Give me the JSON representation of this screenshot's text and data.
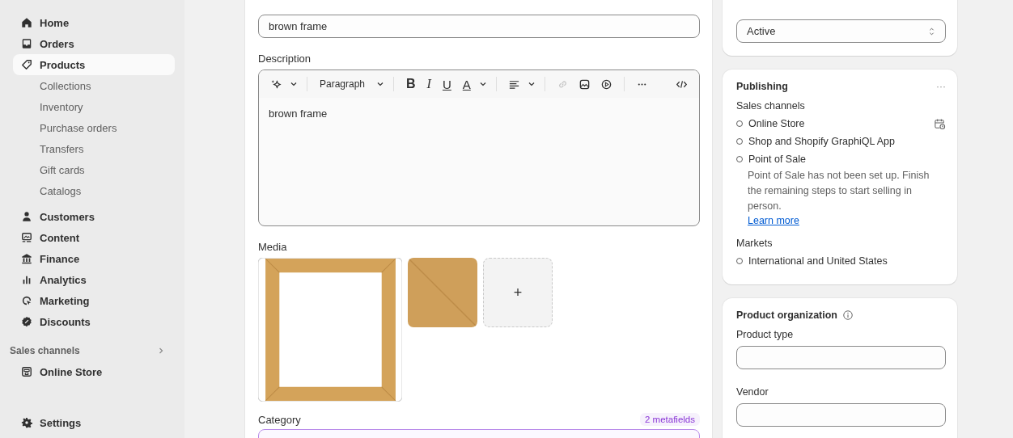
{
  "sidebar": {
    "items": [
      {
        "label": "Home",
        "kind": "nav",
        "selected": false
      },
      {
        "label": "Orders",
        "kind": "nav",
        "selected": false
      },
      {
        "label": "Products",
        "kind": "nav",
        "selected": true
      },
      {
        "label": "Collections",
        "kind": "sub",
        "selected": false
      },
      {
        "label": "Inventory",
        "kind": "sub",
        "selected": false
      },
      {
        "label": "Purchase orders",
        "kind": "sub",
        "selected": false
      },
      {
        "label": "Transfers",
        "kind": "sub",
        "selected": false
      },
      {
        "label": "Gift cards",
        "kind": "sub",
        "selected": false
      },
      {
        "label": "Catalogs",
        "kind": "sub",
        "selected": false
      },
      {
        "label": "Customers",
        "kind": "nav",
        "selected": false
      },
      {
        "label": "Content",
        "kind": "nav",
        "selected": false
      },
      {
        "label": "Finance",
        "kind": "nav",
        "selected": false
      },
      {
        "label": "Analytics",
        "kind": "nav",
        "selected": false
      },
      {
        "label": "Marketing",
        "kind": "nav",
        "selected": false
      },
      {
        "label": "Discounts",
        "kind": "nav",
        "selected": false
      }
    ],
    "section": {
      "title": "Sales channels",
      "items": [
        {
          "label": "Online Store",
          "selected": false
        }
      ]
    },
    "settings": "Settings"
  },
  "product": {
    "title_value": "brown frame",
    "description_label": "Description",
    "toolbar": {
      "style": "Paragraph",
      "bold": "B",
      "italic": "I",
      "underline": "U",
      "text_color_label": "A",
      "link_disabled": true
    },
    "description": "brown frame",
    "media_label": "Media",
    "add_media": "+",
    "category_label": "Category",
    "metafields": "2 metafields"
  },
  "status": {
    "value": "Active"
  },
  "publishing": {
    "title": "Publishing",
    "menu": "···",
    "channels_label": "Sales channels",
    "channels": [
      {
        "name": "Online Store",
        "published": false,
        "scheduled": true
      },
      {
        "name": "Shop and Shopify GraphiQL App",
        "published": false,
        "scheduled": false
      },
      {
        "name": "Point of Sale",
        "published": false,
        "scheduled": false,
        "note": "Point of Sale has not been set up. Finish the remaining steps to start selling in person.",
        "link": "Learn more"
      }
    ],
    "markets_label": "Markets",
    "markets": [
      {
        "name": "International and United States",
        "published": false
      }
    ]
  },
  "organization": {
    "title": "Product organization",
    "fields": [
      {
        "label": "Product type"
      },
      {
        "label": "Vendor"
      }
    ]
  }
}
